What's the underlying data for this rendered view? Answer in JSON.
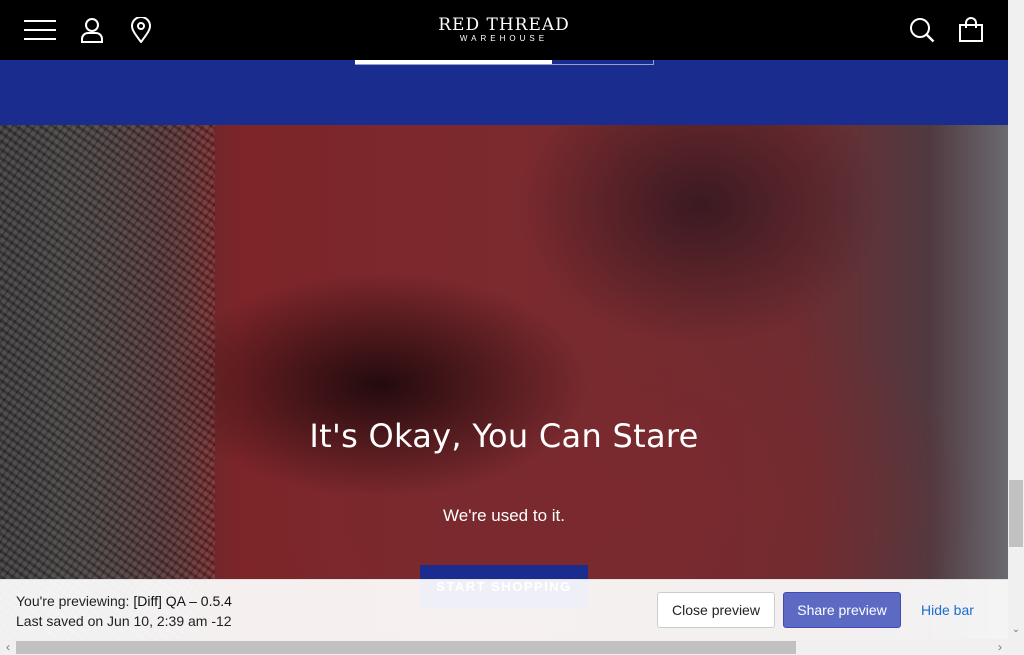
{
  "header": {
    "logo_main": "RED THREAD",
    "logo_sub": "WAREHOUSE",
    "icons": [
      "menu-icon",
      "account-icon",
      "location-pin-icon",
      "search-icon",
      "shopping-bag-icon"
    ]
  },
  "hero": {
    "title": "It's Okay, You Can Stare",
    "subtitle": "We're used to it.",
    "cta_label": "START SHOPPING"
  },
  "preview_bar": {
    "previewing_prefix": "You're previewing: ",
    "theme_name": "[Diff] QA – 0.5.4",
    "last_saved": "Last saved on Jun 10, 2:39 am -12",
    "close_label": "Close preview",
    "share_label": "Share preview",
    "hide_label": "Hide bar"
  },
  "colors": {
    "header_bg": "#000000",
    "brand_blue": "#1b2c8f",
    "share_button": "#5c6ac4",
    "link": "#1a6ecf"
  }
}
